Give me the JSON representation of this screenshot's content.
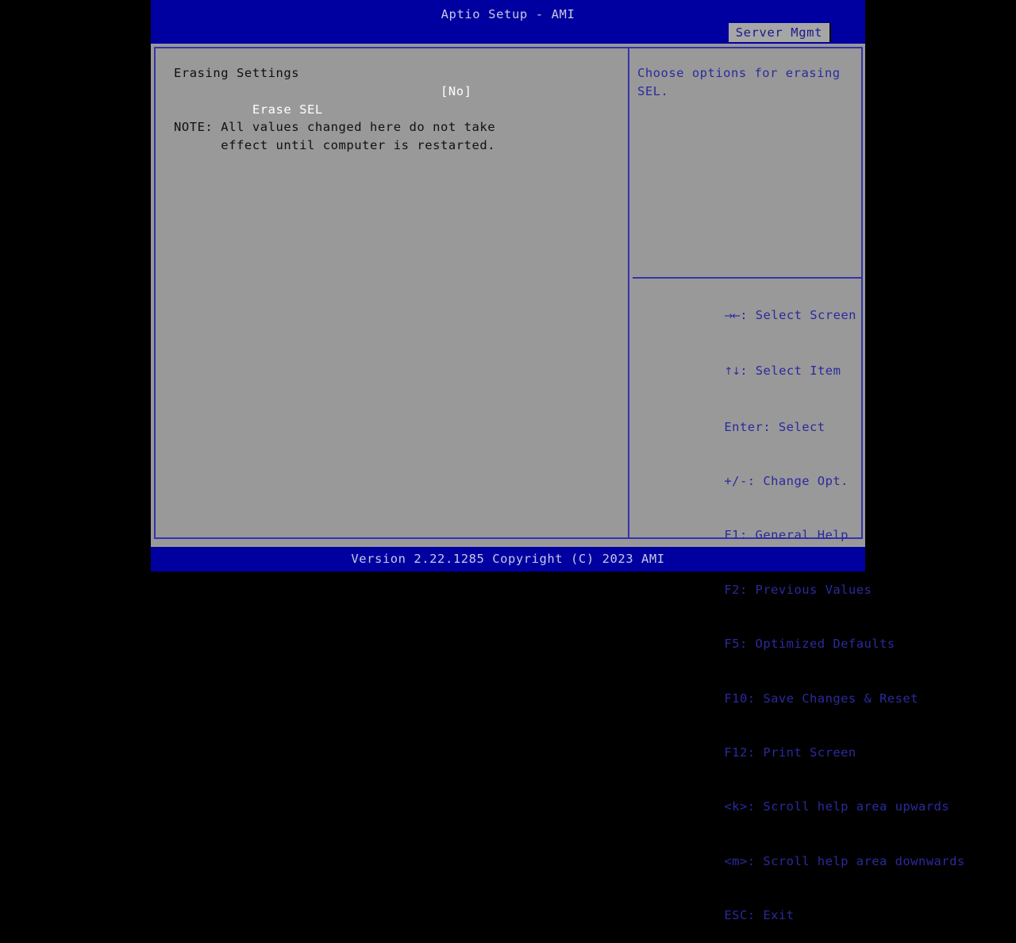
{
  "header": {
    "title": "Aptio Setup - AMI",
    "tabs": [
      {
        "label": "Server Mgmt",
        "active": true
      }
    ]
  },
  "main": {
    "section_title": "Erasing Settings",
    "options": [
      {
        "label": "Erase SEL",
        "value": "[No]",
        "selected": true
      }
    ],
    "note": {
      "line1": "NOTE: All values changed here do not take",
      "line2": "      effect until computer is restarted."
    }
  },
  "help": {
    "description": "Choose options for erasing SEL.",
    "legend": [
      {
        "key": "→←",
        "key_is_glyph": true,
        "text": ": Select Screen"
      },
      {
        "key": "↑↓",
        "key_is_glyph": true,
        "text": ": Select Item"
      },
      {
        "key": "Enter",
        "key_is_glyph": false,
        "text": ": Select"
      },
      {
        "key": "+/-",
        "key_is_glyph": false,
        "text": ": Change Opt."
      },
      {
        "key": "F1",
        "key_is_glyph": false,
        "text": ": General Help"
      },
      {
        "key": "F2",
        "key_is_glyph": false,
        "text": ": Previous Values"
      },
      {
        "key": "F5",
        "key_is_glyph": false,
        "text": ": Optimized Defaults"
      },
      {
        "key": "F10",
        "key_is_glyph": false,
        "text": ": Save Changes & Reset"
      },
      {
        "key": "F12",
        "key_is_glyph": false,
        "text": ": Print Screen"
      },
      {
        "key": "<k>",
        "key_is_glyph": false,
        "text": ": Scroll help area upwards"
      },
      {
        "key": "<m>",
        "key_is_glyph": false,
        "text": ": Scroll help area downwards"
      },
      {
        "key": "ESC",
        "key_is_glyph": false,
        "text": ": Exit"
      }
    ]
  },
  "footer": {
    "version_text": "Version 2.22.1285 Copyright (C) 2023 AMI"
  },
  "colors": {
    "header_blue": "#0000a0",
    "body_gray": "#999999",
    "border_blue": "#3333aa",
    "help_text": "#2a2a9e",
    "selected_white": "#ffffff",
    "static_black": "#101010",
    "tab_bg": "#a6a6a6",
    "footer_text": "#c8c8e8"
  }
}
